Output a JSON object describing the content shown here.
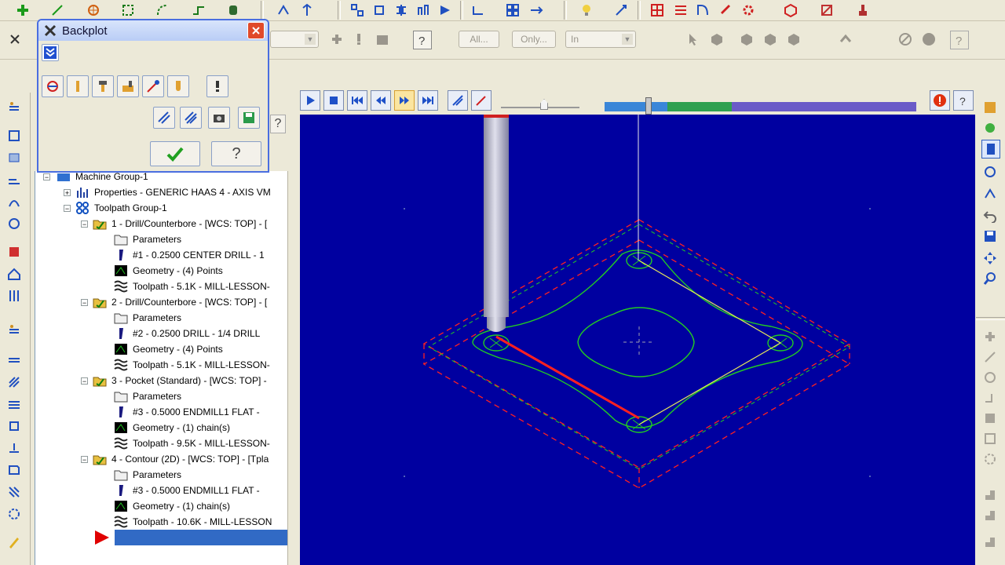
{
  "toolbar": {
    "filters": {
      "all_label": "All...",
      "only_label": "Only...",
      "in_value": "In"
    }
  },
  "backplot": {
    "title": "Backplot",
    "ok_label": "",
    "help_label": "?"
  },
  "tree": {
    "root": "Machine Group-1",
    "properties": "Properties - GENERIC HAAS 4 - AXIS VM",
    "toolpath_group": "Toolpath Group-1",
    "operations": [
      {
        "name": "1 - Drill/Counterbore - [WCS: TOP] - [",
        "parameters": "Parameters",
        "tool": "#1 - 0.2500 CENTER DRILL  -  1",
        "geometry": "Geometry - (4) Points",
        "toolpath": "Toolpath - 5.1K - MILL-LESSON-"
      },
      {
        "name": "2 - Drill/Counterbore - [WCS: TOP] - [",
        "parameters": "Parameters",
        "tool": "#2 - 0.2500 DRILL  -  1/4 DRILL",
        "geometry": "Geometry - (4) Points",
        "toolpath": "Toolpath - 5.1K - MILL-LESSON-"
      },
      {
        "name": "3 - Pocket (Standard) - [WCS: TOP] -",
        "parameters": "Parameters",
        "tool": "#3 - 0.5000 ENDMILL1 FLAT  -  ",
        "geometry": "Geometry - (1) chain(s)",
        "toolpath": "Toolpath - 9.5K - MILL-LESSON-"
      },
      {
        "name": "4 - Contour (2D) - [WCS: TOP] - [Tpla",
        "parameters": "Parameters",
        "tool": "#3 - 0.5000 ENDMILL1 FLAT  -  ",
        "geometry": "Geometry - (1) chain(s)",
        "toolpath": "Toolpath - 10.6K - MILL-LESSON"
      }
    ]
  },
  "colors": {
    "viewport_bg": "#0000a0",
    "toolpath_green": "#22cc22",
    "stock_red": "#ff2222",
    "path_yellow": "#e8e85a",
    "tool_grey": "#b8b8c8",
    "selection_blue": "#316ac5"
  },
  "playback": {
    "progress": 0.16
  }
}
